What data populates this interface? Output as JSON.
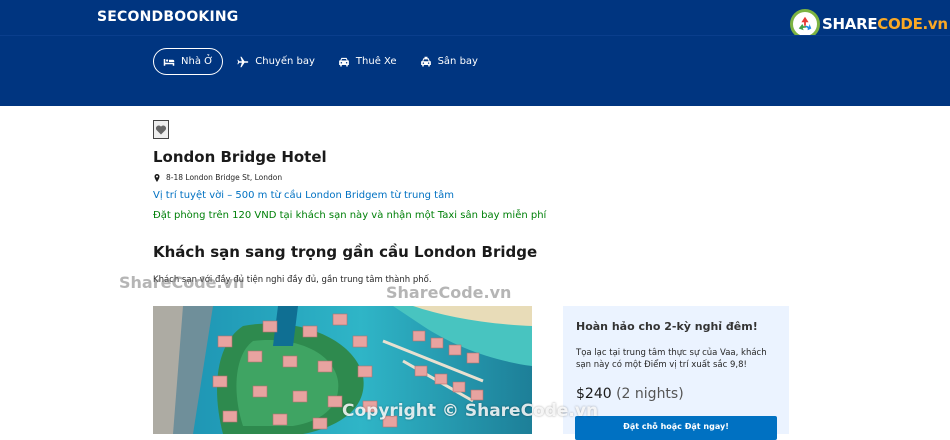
{
  "header": {
    "brand": "SECONDBOOKING",
    "logo": {
      "prefix": "SHARE",
      "suffix": "CODE.vn"
    }
  },
  "nav": {
    "items": [
      {
        "label": "Nhà Ở",
        "icon": "bed-icon",
        "active": true
      },
      {
        "label": "Chuyến bay",
        "icon": "plane-icon",
        "active": false
      },
      {
        "label": "Thuê Xe",
        "icon": "car-icon",
        "active": false
      },
      {
        "label": "Sân bay",
        "icon": "taxi-icon",
        "active": false
      }
    ]
  },
  "hotel": {
    "name": "London Bridge Hotel",
    "address": "8-18 London Bridge St, London",
    "location_highlight": "Vị trí tuyệt vời – 500 m từ cầu London Bridgem từ trung tâm",
    "offer": "Đặt phòng trên 120 VND tại khách sạn này và nhận một Taxi sân bay miễn phí",
    "section_title": "Khách sạn sang trọng gần cầu London Bridge",
    "description": "Khách sạn với đầy đủ tiện nghi đầy đủ, gần trung tâm thành phố."
  },
  "sidebar": {
    "title": "Hoàn hảo cho 2-kỳ nghỉ đêm!",
    "text": "Tọa lạc tại trung tâm thực sự của Vaa, khách sạn này có một Điểm vị trí xuất sắc 9,8!",
    "price": "$240",
    "nights": "(2 nights)",
    "button_label": "Đặt chỗ hoặc Đặt ngay!"
  },
  "watermarks": {
    "left": "ShareCode.vn",
    "center": "ShareCode.vn",
    "bottom": "Copyright © ShareCode.vn"
  },
  "colors": {
    "header": "#003580",
    "link": "#0071c2",
    "offer": "#008009",
    "sidebar_bg": "#ebf3ff",
    "button": "#0071c2"
  }
}
